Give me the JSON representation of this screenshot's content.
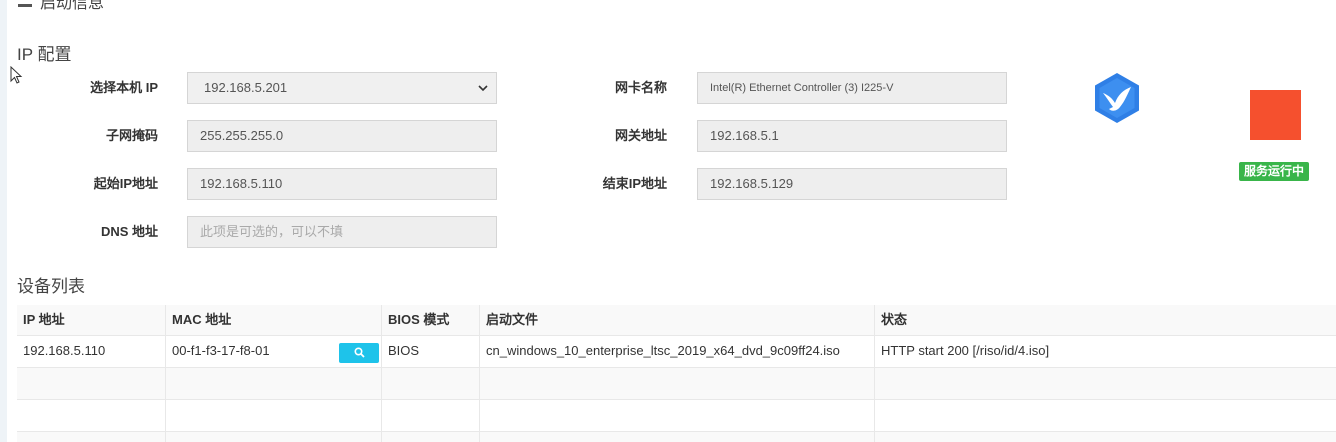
{
  "header": {
    "title": "启动信息",
    "title_icon": "server-icon"
  },
  "ip_config": {
    "section_title": "IP 配置",
    "fields": {
      "local_ip": {
        "label": "选择本机 IP",
        "value": "192.168.5.201"
      },
      "subnet_mask": {
        "label": "子网掩码",
        "value": "255.255.255.0"
      },
      "start_ip": {
        "label": "起始IP地址",
        "value": "192.168.5.110"
      },
      "dns": {
        "label": "DNS 地址",
        "placeholder": "此项是可选的，可以不填"
      },
      "nic_name": {
        "label": "网卡名称",
        "value": "Intel(R) Ethernet Controller (3) I225-V"
      },
      "gateway": {
        "label": "网关地址",
        "value": "192.168.5.1"
      },
      "end_ip": {
        "label": "结束IP地址",
        "value": "192.168.5.129"
      }
    }
  },
  "service": {
    "logo_icon": "bird-hexagon-logo",
    "stop_button_color": "#f5502e",
    "status_label": "服务运行中",
    "status_color": "#39b54a"
  },
  "devices": {
    "section_title": "设备列表",
    "columns": [
      "IP 地址",
      "MAC 地址",
      "BIOS 模式",
      "启动文件",
      "状态"
    ],
    "rows": [
      {
        "ip": "192.168.5.110",
        "mac": "00-f1-f3-17-f8-01",
        "bios": "BIOS",
        "boot_file": "cn_windows_10_enterprise_ltsc_2019_x64_dvd_9c09ff24.iso",
        "status": "HTTP start 200 [/riso/id/4.iso]"
      }
    ],
    "search_icon": "search-icon",
    "accent_color": "#1ec3ea"
  }
}
